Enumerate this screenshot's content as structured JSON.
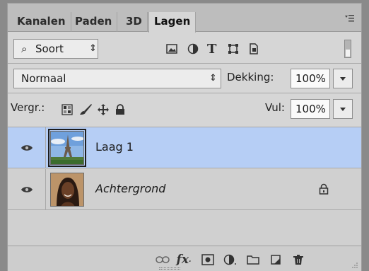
{
  "tabs": [
    {
      "label": "Kanalen",
      "active": false
    },
    {
      "label": "Paden",
      "active": false
    },
    {
      "label": "3D",
      "active": false
    },
    {
      "label": "Lagen",
      "active": true
    }
  ],
  "filter": {
    "kind_label": "Soort"
  },
  "blend": {
    "mode": "Normaal",
    "opacity_label": "Dekking:",
    "opacity_value": "100%"
  },
  "lock": {
    "label": "Vergr.:",
    "fill_label": "Vul:",
    "fill_value": "100%"
  },
  "layers": [
    {
      "name": "Laag 1",
      "selected": true,
      "locked": false,
      "italic": false
    },
    {
      "name": "Achtergrond",
      "selected": false,
      "locked": true,
      "italic": true
    }
  ],
  "colors": {
    "selection": "#b6cef5",
    "panel": "#d6d6d6"
  }
}
